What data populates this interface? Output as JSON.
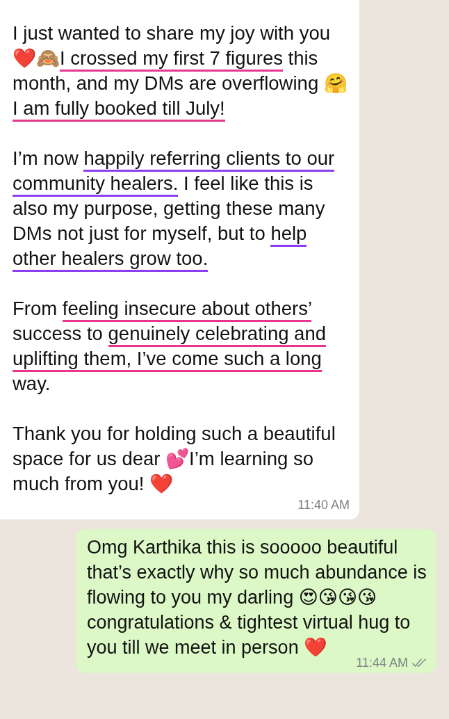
{
  "messages": [
    {
      "kind": "incoming",
      "paragraphs": [
        [
          {
            "text": "I just wanted to share my joy with you ❤️🙈"
          },
          {
            "text": "I crossed my first 7 figures",
            "color": "#e8368f"
          },
          {
            "text": " this month, and my DMs are overflowing 🤗"
          },
          {
            "text": "I am fully booked till July!",
            "color": "#e8368f"
          }
        ],
        [
          {
            "text": "I’m now "
          },
          {
            "text": "happily referring clients to our community healers.",
            "color": "#8b3ff0"
          },
          {
            "text": " I feel like this is also my purpose, getting these many DMs not just for myself, but to "
          },
          {
            "text": "help other healers grow too.",
            "color": "#8b3ff0"
          }
        ],
        [
          {
            "text": "From "
          },
          {
            "text": "feeling insecure about others’",
            "color": "#e8368f"
          },
          {
            "text": " success to "
          },
          {
            "text": "genuinely celebrating and ",
            "color": "#e8368f"
          },
          {
            "text": "uplifting them, I’ve come such a long",
            "color": "#e8368f"
          },
          {
            "text": " way."
          }
        ],
        [
          {
            "text": "Thank you for holding such a beautiful space for us dear 💕I’m learning so much from you! ❤️"
          }
        ]
      ],
      "time": "11:40 AM"
    },
    {
      "kind": "outgoing",
      "paragraphs": [
        [
          {
            "text": "Omg Karthika this is sooooo beautiful that’s exactly why so much abundance is flowing to you my darling 😍😘😘😘 congratulations & tightest virtual hug to you till we meet in person ❤️"
          }
        ]
      ],
      "time": "11:44 AM",
      "read": false
    }
  ]
}
